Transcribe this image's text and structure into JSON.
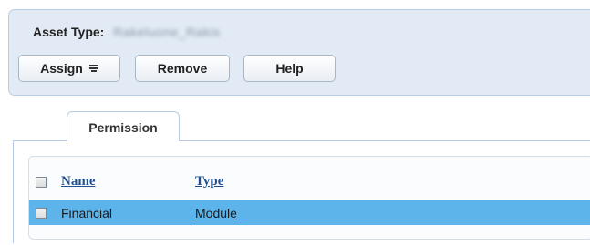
{
  "header": {
    "asset_type_label": "Asset Type:",
    "asset_type_value": "Rakeluone_Rakis"
  },
  "toolbar": {
    "assign_label": "Assign",
    "remove_label": "Remove",
    "help_label": "Help"
  },
  "tabs": [
    {
      "label": "Permission",
      "selected": true
    }
  ],
  "table": {
    "columns": [
      "Name",
      "Type"
    ],
    "rows": [
      {
        "name": "Financial",
        "type": "Module",
        "selected": true
      }
    ]
  },
  "colors": {
    "header_bg": "#e2ebf5",
    "selected_row": "#5cb4ea",
    "link_color": "#1f4f8e"
  },
  "icons": [
    "menu-dropdown-icon",
    "checkbox"
  ]
}
